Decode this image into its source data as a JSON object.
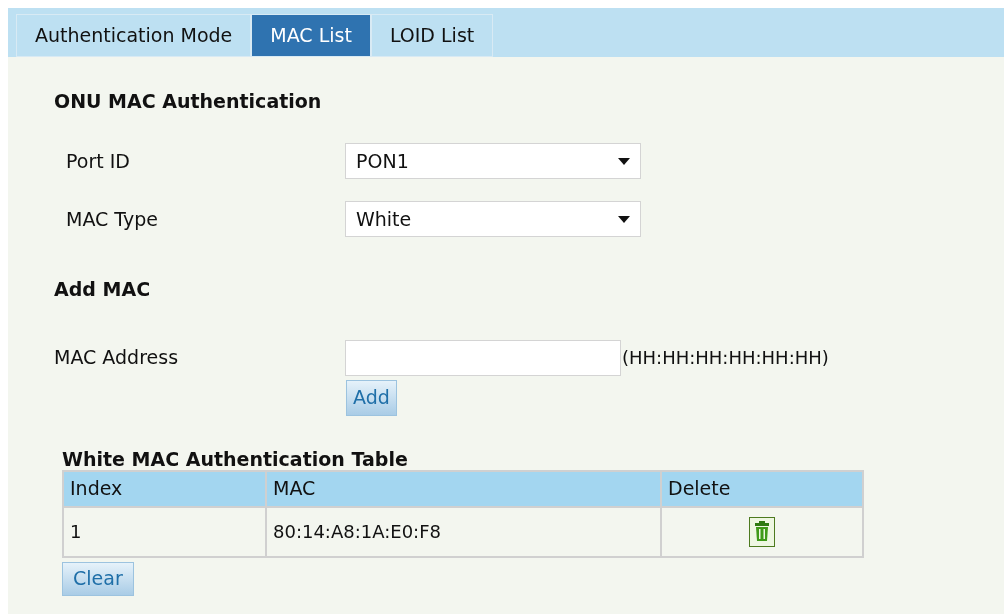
{
  "tabs": [
    {
      "label": "Authentication Mode",
      "selected": false
    },
    {
      "label": "MAC List",
      "selected": true
    },
    {
      "label": "LOID List",
      "selected": false
    }
  ],
  "section_title": "ONU MAC Authentication",
  "settings": [
    {
      "label": "Port ID",
      "value": "PON1"
    },
    {
      "label": "MAC Type",
      "value": "White"
    }
  ],
  "add_section": {
    "title": "Add MAC",
    "label": "MAC Address",
    "hint": "(HH:HH:HH:HH:HH:HH)",
    "button": "Add"
  },
  "table": {
    "title": "White MAC Authentication Table",
    "columns": [
      "Index",
      "MAC",
      "Delete"
    ],
    "rows": [
      {
        "index": "1",
        "mac": "80:14:A8:1A:E0:F8"
      }
    ]
  },
  "clear_button": "Clear"
}
